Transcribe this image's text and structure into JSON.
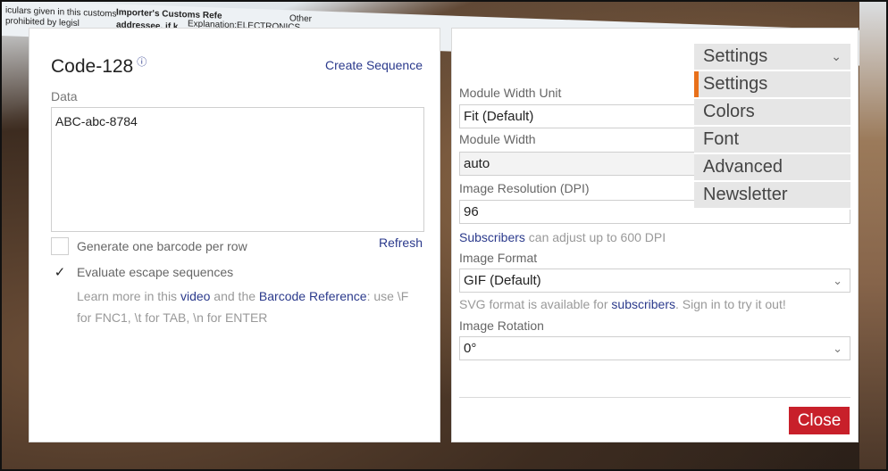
{
  "left": {
    "title": "Code-128",
    "info_icon": "ⓘ",
    "create_sequence": "Create Sequence",
    "data_label": "Data",
    "data_value": "ABC-abc-8784",
    "per_row_label": "Generate one barcode per row",
    "refresh": "Refresh",
    "escape_label": "Evaluate escape sequences",
    "escape_checked": "✓",
    "help": {
      "part1": "Learn more in this ",
      "link1": "video",
      "part2": " and the ",
      "link2": "Barcode Reference",
      "part3": ": use \\F for FNC1, \\t for TAB, \\n for ENTER"
    }
  },
  "right": {
    "module_width_unit_label": "Module Width Unit",
    "module_width_unit_value": "Fit (Default)",
    "module_width_label": "Module Width",
    "module_width_value": "auto",
    "resolution_label": "Image Resolution (DPI)",
    "resolution_value": "96",
    "resolution_note_link": "Subscribers",
    "resolution_note_text": " can adjust up to 600 DPI",
    "format_label": "Image Format",
    "format_value": "GIF (Default)",
    "format_note_pre": "SVG format is available for ",
    "format_note_link": "subscribers",
    "format_note_post": ". Sign in to try it out!",
    "rotation_label": "Image Rotation",
    "rotation_value": "0°",
    "close": "Close"
  },
  "nav": {
    "header": "Settings",
    "items": [
      "Settings",
      "Colors",
      "Font",
      "Advanced",
      "Newsletter"
    ]
  },
  "background_text": {
    "line1": "iculars given in this customs",
    "line2": "prohibited by legisl",
    "line3": "Importer's Customs Refe",
    "line4": "addressee, if k",
    "line5": "Explanation:ELECTRONICS",
    "line6": "Other"
  },
  "colors": {
    "accent": "#c8202a",
    "link": "#2b3a8c",
    "nav_marker": "#e8701a"
  }
}
